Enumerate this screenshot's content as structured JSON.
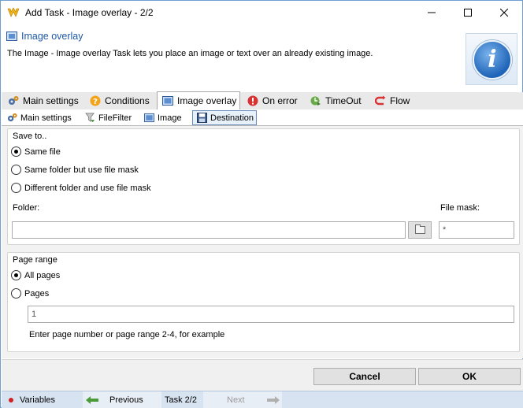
{
  "window": {
    "title": "Add Task - Image overlay - 2/2",
    "minimize": "—",
    "maximize": "☐",
    "close": "✕"
  },
  "header": {
    "title": "Image overlay",
    "description": "The Image - Image overlay Task lets you place an image or text over an already existing image."
  },
  "tabs": [
    {
      "label": "Main settings",
      "icon": "gears-icon"
    },
    {
      "label": "Conditions",
      "icon": "question-icon"
    },
    {
      "label": "Image overlay",
      "icon": "image-icon",
      "active": true
    },
    {
      "label": "On error",
      "icon": "error-icon"
    },
    {
      "label": "TimeOut",
      "icon": "timeout-icon"
    },
    {
      "label": "Flow",
      "icon": "flow-icon"
    }
  ],
  "subtabs": [
    {
      "label": "Main settings",
      "icon": "gears-icon"
    },
    {
      "label": "FileFilter",
      "icon": "filter-icon"
    },
    {
      "label": "Image",
      "icon": "image-icon"
    },
    {
      "label": "Destination",
      "icon": "disk-icon",
      "active": true
    }
  ],
  "save_to": {
    "title": "Save to..",
    "options": [
      {
        "label": "Same file",
        "selected": true
      },
      {
        "label": "Same folder but use file mask",
        "selected": false
      },
      {
        "label": "Different folder and use file mask",
        "selected": false
      }
    ],
    "folder_label": "Folder:",
    "folder_value": "",
    "filemask_label": "File mask:",
    "filemask_value": "*"
  },
  "page_range": {
    "title": "Page range",
    "options": [
      {
        "label": "All pages",
        "selected": true
      },
      {
        "label": "Pages",
        "selected": false
      }
    ],
    "pages_value": "1",
    "hint": "Enter page number or page range 2-4, for example"
  },
  "buttons": {
    "cancel": "Cancel",
    "ok": "OK"
  },
  "statusbar": {
    "variables": "Variables",
    "previous": "Previous",
    "task": "Task 2/2",
    "next": "Next"
  }
}
